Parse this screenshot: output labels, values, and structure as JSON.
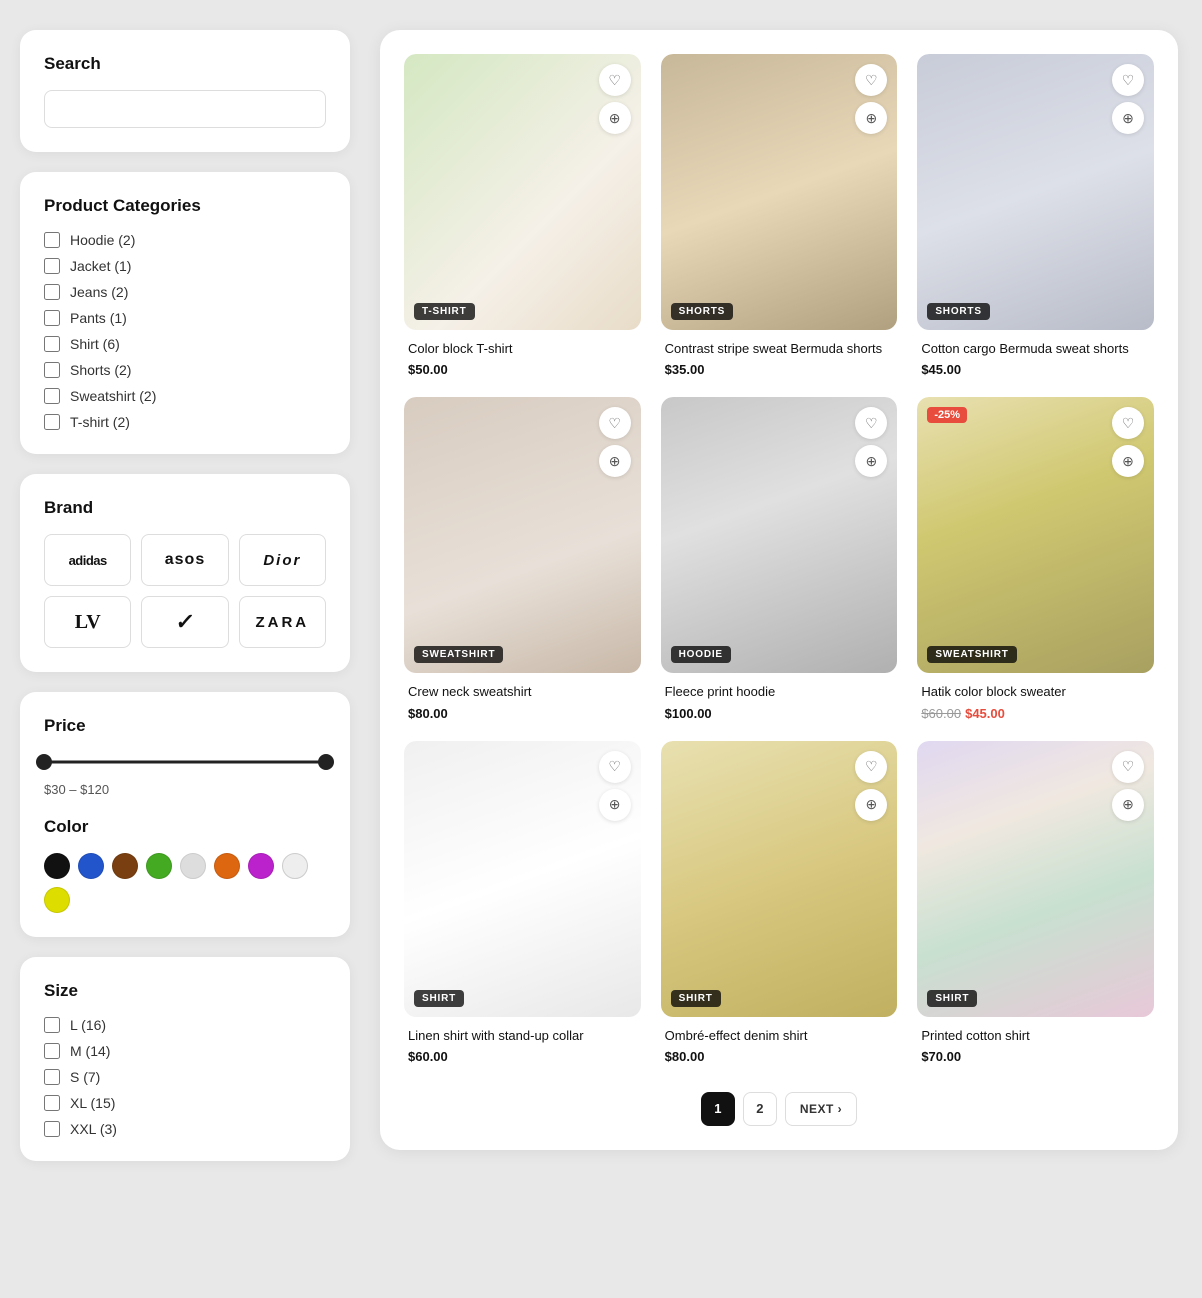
{
  "sidebar": {
    "search": {
      "title": "Search",
      "placeholder": ""
    },
    "categories": {
      "title": "Product Categories",
      "items": [
        {
          "label": "Hoodie (2)",
          "checked": false
        },
        {
          "label": "Jacket (1)",
          "checked": false
        },
        {
          "label": "Jeans (2)",
          "checked": false
        },
        {
          "label": "Pants (1)",
          "checked": false
        },
        {
          "label": "Shirt (6)",
          "checked": false
        },
        {
          "label": "Shorts (2)",
          "checked": false
        },
        {
          "label": "Sweatshirt (2)",
          "checked": false
        },
        {
          "label": "T-shirt (2)",
          "checked": false
        }
      ]
    },
    "brands": {
      "title": "Brand",
      "items": [
        "adidas",
        "asos",
        "Dior",
        "LV",
        "Nike",
        "ZARA"
      ]
    },
    "price": {
      "title": "Price",
      "min": 30,
      "max": 120,
      "label": "$30 – $120"
    },
    "color": {
      "title": "Color",
      "swatches": [
        "#111111",
        "#2255cc",
        "#7a3f10",
        "#44aa22",
        "#dddddd",
        "#dd6611",
        "#bb22cc",
        "#eeeeee",
        "#dddd00"
      ]
    },
    "size": {
      "title": "Size",
      "items": [
        {
          "label": "L (16)",
          "checked": false
        },
        {
          "label": "M (14)",
          "checked": false
        },
        {
          "label": "S (7)",
          "checked": false
        },
        {
          "label": "XL (15)",
          "checked": false
        },
        {
          "label": "XXL (3)",
          "checked": false
        }
      ]
    }
  },
  "products": [
    {
      "id": 1,
      "name": "Color block T-shirt",
      "price": "$50.00",
      "old_price": null,
      "sale_label": null,
      "badge": "T-SHIRT",
      "img_class": "img-tshirt"
    },
    {
      "id": 2,
      "name": "Contrast stripe sweat Bermuda shorts",
      "price": "$35.00",
      "old_price": null,
      "sale_label": null,
      "badge": "SHORTS",
      "img_class": "img-shorts1"
    },
    {
      "id": 3,
      "name": "Cotton cargo Bermuda sweat shorts",
      "price": "$45.00",
      "old_price": null,
      "sale_label": null,
      "badge": "SHORTS",
      "img_class": "img-shorts2"
    },
    {
      "id": 4,
      "name": "Crew neck sweatshirt",
      "price": "$80.00",
      "old_price": null,
      "sale_label": null,
      "badge": "SWEATSHIRT",
      "img_class": "img-sweatshirt"
    },
    {
      "id": 5,
      "name": "Fleece print hoodie",
      "price": "$100.00",
      "old_price": null,
      "sale_label": null,
      "badge": "HOODIE",
      "img_class": "img-hoodie"
    },
    {
      "id": 6,
      "name": "Hatik color block sweater",
      "price": "$45.00",
      "old_price": "$60.00",
      "sale_label": "-25%",
      "badge": "SWEATSHIRT",
      "img_class": "img-sweater"
    },
    {
      "id": 7,
      "name": "Linen shirt with stand-up collar",
      "price": "$60.00",
      "old_price": null,
      "sale_label": null,
      "badge": "SHIRT",
      "img_class": "img-linen"
    },
    {
      "id": 8,
      "name": "Ombré-effect denim shirt",
      "price": "$80.00",
      "old_price": null,
      "sale_label": null,
      "badge": "SHIRT",
      "img_class": "img-ombre"
    },
    {
      "id": 9,
      "name": "Printed cotton shirt",
      "price": "$70.00",
      "old_price": null,
      "sale_label": null,
      "badge": "SHIRT",
      "img_class": "img-printed"
    }
  ],
  "pagination": {
    "pages": [
      "1",
      "2"
    ],
    "active": "1",
    "next_label": "NEXT ›"
  }
}
